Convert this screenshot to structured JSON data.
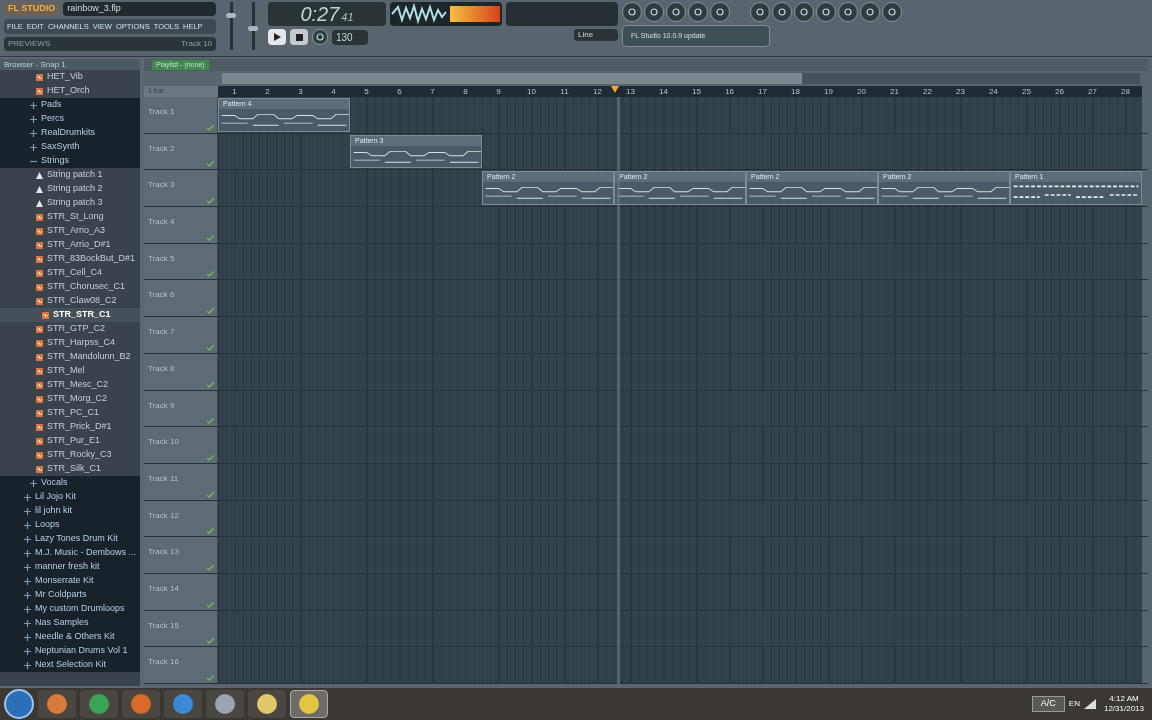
{
  "app": {
    "logo": "FL STUDIO",
    "project": "rainbow_3.flp"
  },
  "menu": [
    {
      "label": "FILE"
    },
    {
      "label": "EDIT"
    },
    {
      "label": "CHANNELS"
    },
    {
      "label": "VIEW"
    },
    {
      "label": "OPTIONS"
    },
    {
      "label": "TOOLS"
    },
    {
      "label": "HELP"
    }
  ],
  "hint_bar": {
    "left": "PREVIEWS",
    "right": "Track 10"
  },
  "transport": {
    "time": "0:27",
    "time_small": "41",
    "playing": true,
    "tempo": "130",
    "snap": "Line",
    "master_volume": {
      "level": 0.75
    },
    "master_pitch": {
      "level": 0.45
    }
  },
  "news_panel": {
    "text": "FL Studio 10.0.9 update"
  },
  "browser": {
    "title": "Browser - Snap 1",
    "items": [
      {
        "kind": "file",
        "name": "HET_Vib",
        "selected": false
      },
      {
        "kind": "file",
        "name": "HET_Orch",
        "selected": false
      },
      {
        "kind": "folder",
        "name": "Pads",
        "selected": false,
        "expanded": false
      },
      {
        "kind": "folder",
        "name": "Percs",
        "selected": false,
        "expanded": false
      },
      {
        "kind": "folder",
        "name": "RealDrumkits",
        "selected": false,
        "expanded": false
      },
      {
        "kind": "folder",
        "name": "SaxSynth",
        "selected": false,
        "expanded": false
      },
      {
        "kind": "folder",
        "name": "Strings",
        "selected": false,
        "expanded": true,
        "children": [
          {
            "kind": "preset",
            "name": "String patch 1",
            "selected": false
          },
          {
            "kind": "preset",
            "name": "String patch 2",
            "selected": false
          },
          {
            "kind": "preset",
            "name": "String patch 3",
            "selected": false
          },
          {
            "kind": "file",
            "name": "STR_St_Long",
            "selected": false
          },
          {
            "kind": "file",
            "name": "STR_Arrio_A3",
            "selected": false
          },
          {
            "kind": "file",
            "name": "STR_Arrio_D#1",
            "selected": false
          },
          {
            "kind": "file",
            "name": "STR_83BockBut_D#1",
            "selected": false
          },
          {
            "kind": "file",
            "name": "STR_Cell_C4",
            "selected": false
          },
          {
            "kind": "file",
            "name": "STR_Chorusec_C1",
            "selected": false
          },
          {
            "kind": "file",
            "name": "STR_Claw08_C2",
            "selected": false
          },
          {
            "kind": "file",
            "name": "STR_STR_C1",
            "selected": true
          },
          {
            "kind": "file",
            "name": "STR_GTP_C2",
            "selected": false
          },
          {
            "kind": "file",
            "name": "STR_Harpss_C4",
            "selected": false
          },
          {
            "kind": "file",
            "name": "STR_Mandolunn_B2",
            "selected": false
          },
          {
            "kind": "file",
            "name": "STR_Mel",
            "selected": false
          },
          {
            "kind": "file",
            "name": "STR_Mesc_C2",
            "selected": false
          },
          {
            "kind": "file",
            "name": "STR_Morg_C2",
            "selected": false
          },
          {
            "kind": "file",
            "name": "STR_PC_C1",
            "selected": false
          },
          {
            "kind": "file",
            "name": "STR_Prick_D#1",
            "selected": false
          },
          {
            "kind": "file",
            "name": "STR_Pur_E1",
            "selected": false
          },
          {
            "kind": "file",
            "name": "STR_Rocky_C3",
            "selected": false
          },
          {
            "kind": "file",
            "name": "STR_Silk_C1",
            "selected": false
          }
        ]
      },
      {
        "kind": "folder",
        "name": "Vocals",
        "selected": false,
        "expanded": false
      },
      {
        "kind": "root",
        "name": "Lil Jojo Kit",
        "selected": false,
        "expanded": false
      },
      {
        "kind": "root",
        "name": "lil john kit",
        "selected": false,
        "expanded": false
      },
      {
        "kind": "root",
        "name": "Loops",
        "selected": false,
        "expanded": false
      },
      {
        "kind": "root",
        "name": "Lazy Tones Drum Kit",
        "selected": false,
        "expanded": false
      },
      {
        "kind": "root",
        "name": "M.J. Music - Dembows ...",
        "selected": false,
        "expanded": false
      },
      {
        "kind": "root",
        "name": "manner fresh kit",
        "selected": false,
        "expanded": false
      },
      {
        "kind": "root",
        "name": "Monserrate Kit",
        "selected": false,
        "expanded": false
      },
      {
        "kind": "root",
        "name": "Mr Coldparts",
        "selected": false,
        "expanded": false
      },
      {
        "kind": "root",
        "name": "My custom Drumloops",
        "selected": false,
        "expanded": false
      },
      {
        "kind": "root",
        "name": "Nas Samples",
        "selected": false,
        "expanded": false
      },
      {
        "kind": "root",
        "name": "Needle & Others Kit",
        "selected": false,
        "expanded": false
      },
      {
        "kind": "root",
        "name": "Neptunian Drums Vol 1",
        "selected": false,
        "expanded": false
      },
      {
        "kind": "root",
        "name": "Next Selection Kit",
        "selected": false,
        "expanded": false
      }
    ]
  },
  "playlist": {
    "title": "Playlist - (none)",
    "zoom_label": "1 bar",
    "playhead": {
      "level": 0.43
    },
    "ruler": [
      "1",
      "2",
      "3",
      "4",
      "5",
      "6",
      "7",
      "8",
      "9",
      "10",
      "11",
      "12",
      "13",
      "14",
      "15",
      "16",
      "17",
      "18",
      "19",
      "20",
      "21",
      "22",
      "23",
      "24",
      "25",
      "26",
      "27",
      "28"
    ],
    "tracks": [
      {
        "name": "Track 1",
        "clips": [
          {
            "label": "Pattern 4",
            "kind": "melody"
          }
        ]
      },
      {
        "name": "Track 2",
        "clips": [
          {
            "kind": "empty"
          },
          {
            "label": "Pattern 3",
            "kind": "melody"
          }
        ]
      },
      {
        "name": "Track 3",
        "clips": [
          {
            "kind": "empty"
          },
          {
            "kind": "empty"
          },
          {
            "label": "Pattern 2",
            "kind": "melody"
          },
          {
            "label": "Pattern 2",
            "kind": "melody"
          },
          {
            "label": "Pattern 2",
            "kind": "melody"
          },
          {
            "label": "Pattern 2",
            "kind": "melody"
          },
          {
            "label": "Pattern 1",
            "kind": "steps"
          }
        ]
      },
      {
        "name": "Track 4"
      },
      {
        "name": "Track 5"
      },
      {
        "name": "Track 6"
      },
      {
        "name": "Track 7"
      },
      {
        "name": "Track 8"
      },
      {
        "name": "Track 9"
      },
      {
        "name": "Track 10"
      },
      {
        "name": "Track 11"
      },
      {
        "name": "Track 12"
      },
      {
        "name": "Track 13"
      },
      {
        "name": "Track 14"
      },
      {
        "name": "Track 15"
      },
      {
        "name": "Track 16"
      }
    ]
  },
  "taskbar": {
    "language": "EN",
    "ac": "A/C",
    "time": "4:12 AM",
    "date": "12/31/2013"
  }
}
